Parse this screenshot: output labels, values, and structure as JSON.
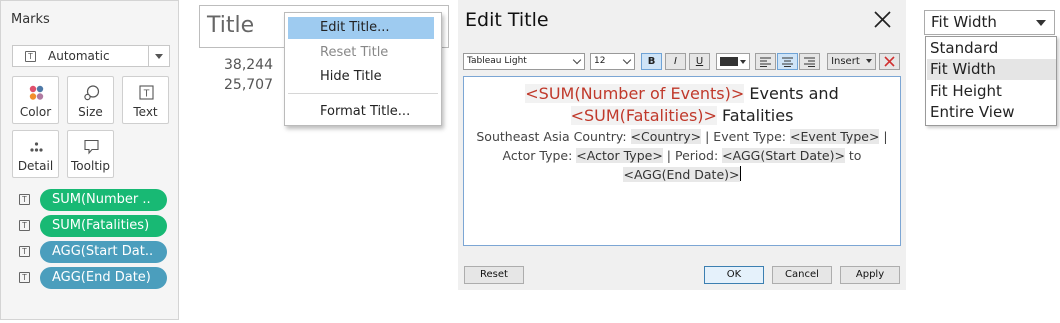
{
  "marks": {
    "title": "Marks",
    "mark_type": "Automatic",
    "buttons": {
      "color": "Color",
      "size": "Size",
      "text": "Text",
      "detail": "Detail",
      "tooltip": "Tooltip"
    },
    "pills": [
      {
        "label": "SUM(Number ..",
        "color": "#18b974"
      },
      {
        "label": "SUM(Fatalities)",
        "color": "#18b974"
      },
      {
        "label": "AGG(Start Dat..",
        "color": "#4b9ebd"
      },
      {
        "label": "AGG(End Date)",
        "color": "#4b9ebd"
      }
    ]
  },
  "sheet": {
    "title": "Title",
    "values": [
      "38,244",
      "25,707"
    ]
  },
  "context_menu": {
    "items": [
      "Edit Title...",
      "Reset Title",
      "Hide Title",
      "Format Title..."
    ]
  },
  "dialog": {
    "title": "Edit Title",
    "toolbar": {
      "font": "Tableau Light",
      "size": "12",
      "bold": "B",
      "italic": "I",
      "underline": "U",
      "insert": "Insert"
    },
    "editor": {
      "field_events": "<SUM(Number of Events)>",
      "text_events": " Events and",
      "field_fatalities": "<SUM(Fatalities)>",
      "text_fatalities": " Fatalities",
      "t1": "Southeast Asia Country: ",
      "f_country": "<Country>",
      "t2": " | Event Type: ",
      "f_event_type": "<Event Type>",
      "t3": " | Actor Type: ",
      "f_actor_type": "<Actor Type>",
      "t4": " | Period: ",
      "f_start": "<AGG(Start Date)>",
      "t5": " to ",
      "f_end": "<AGG(End Date)>"
    },
    "buttons": {
      "reset": "Reset",
      "ok": "OK",
      "cancel": "Cancel",
      "apply": "Apply"
    }
  },
  "fit": {
    "selected": "Fit Width",
    "options": [
      "Standard",
      "Fit Width",
      "Fit Height",
      "Entire View"
    ]
  },
  "colors": {
    "menu_highlight": "#9ecbf0",
    "field_red": "#c0392b"
  }
}
